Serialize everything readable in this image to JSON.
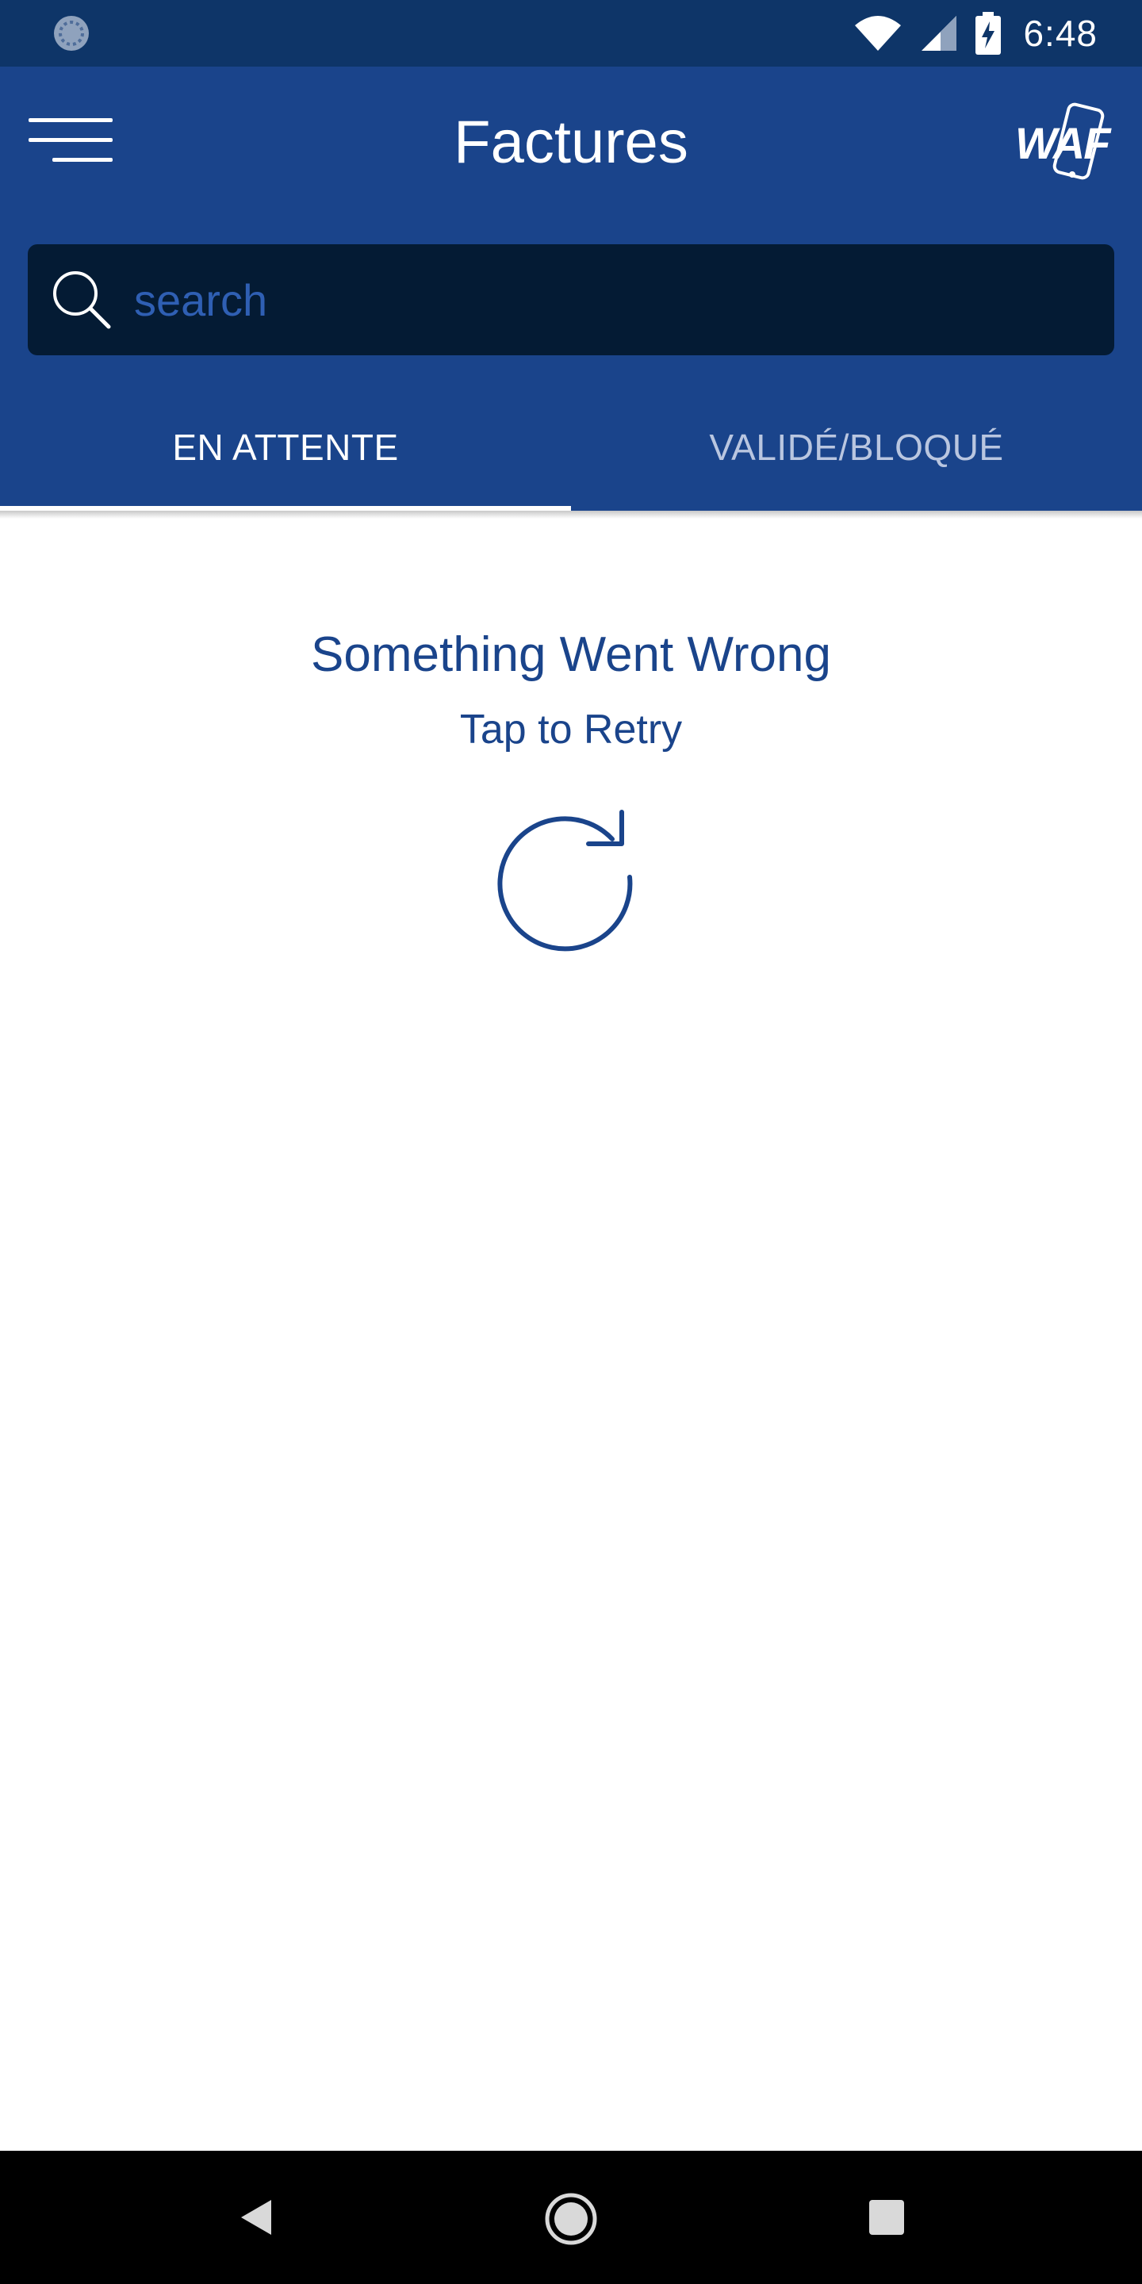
{
  "status_bar": {
    "time": "6:48"
  },
  "header": {
    "title": "Factures",
    "logo_text": "WAF"
  },
  "search": {
    "placeholder": "search",
    "value": ""
  },
  "tabs": [
    {
      "label": "EN ATTENTE",
      "active": true
    },
    {
      "label": "VALIDÉ/BLOQUÉ",
      "active": false
    }
  ],
  "error": {
    "title": "Something Went Wrong",
    "retry": "Tap to Retry"
  },
  "icons": {
    "menu": "hamburger-menu-icon",
    "search": "search-icon",
    "retry": "refresh-icon",
    "back": "back-triangle-icon",
    "home": "home-circle-icon",
    "recents": "recents-square-icon"
  },
  "colors": {
    "status_bar": "#0e3568",
    "app_bar": "#1a448b",
    "search_bg": "#041b34",
    "accent_text": "#1a448b",
    "tab_inactive": "#b9c6e0"
  }
}
